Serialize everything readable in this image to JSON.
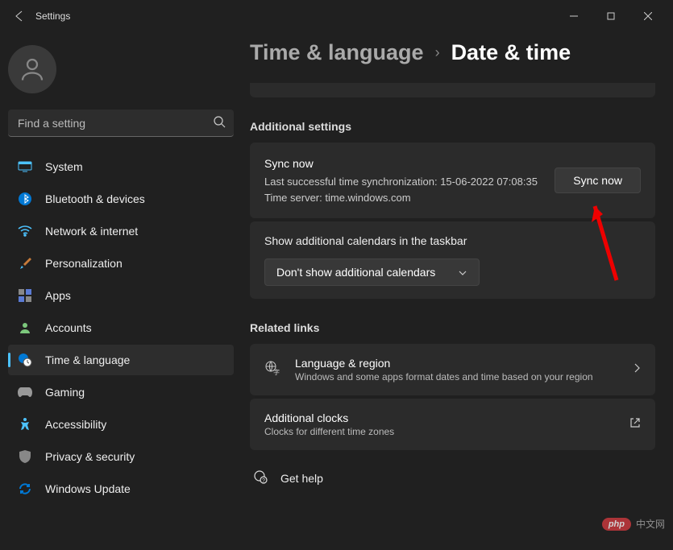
{
  "titlebar": {
    "app_title": "Settings"
  },
  "search": {
    "placeholder": "Find a setting"
  },
  "nav": {
    "items": [
      {
        "label": "System"
      },
      {
        "label": "Bluetooth & devices"
      },
      {
        "label": "Network & internet"
      },
      {
        "label": "Personalization"
      },
      {
        "label": "Apps"
      },
      {
        "label": "Accounts"
      },
      {
        "label": "Time & language"
      },
      {
        "label": "Gaming"
      },
      {
        "label": "Accessibility"
      },
      {
        "label": "Privacy & security"
      },
      {
        "label": "Windows Update"
      }
    ]
  },
  "breadcrumb": {
    "parent": "Time & language",
    "current": "Date & time"
  },
  "sections": {
    "additional": "Additional settings",
    "related": "Related links"
  },
  "sync": {
    "title": "Sync now",
    "last_sync": "Last successful time synchronization: 15-06-2022 07:08:35",
    "server": "Time server: time.windows.com",
    "button": "Sync now"
  },
  "calendar": {
    "label": "Show additional calendars in the taskbar",
    "selected": "Don't show additional calendars"
  },
  "links": {
    "lang": {
      "title": "Language & region",
      "desc": "Windows and some apps format dates and time based on your region"
    },
    "clocks": {
      "title": "Additional clocks",
      "desc": "Clocks for different time zones"
    }
  },
  "help": {
    "label": "Get help"
  },
  "watermark": {
    "badge": "php",
    "text": "中文网"
  }
}
